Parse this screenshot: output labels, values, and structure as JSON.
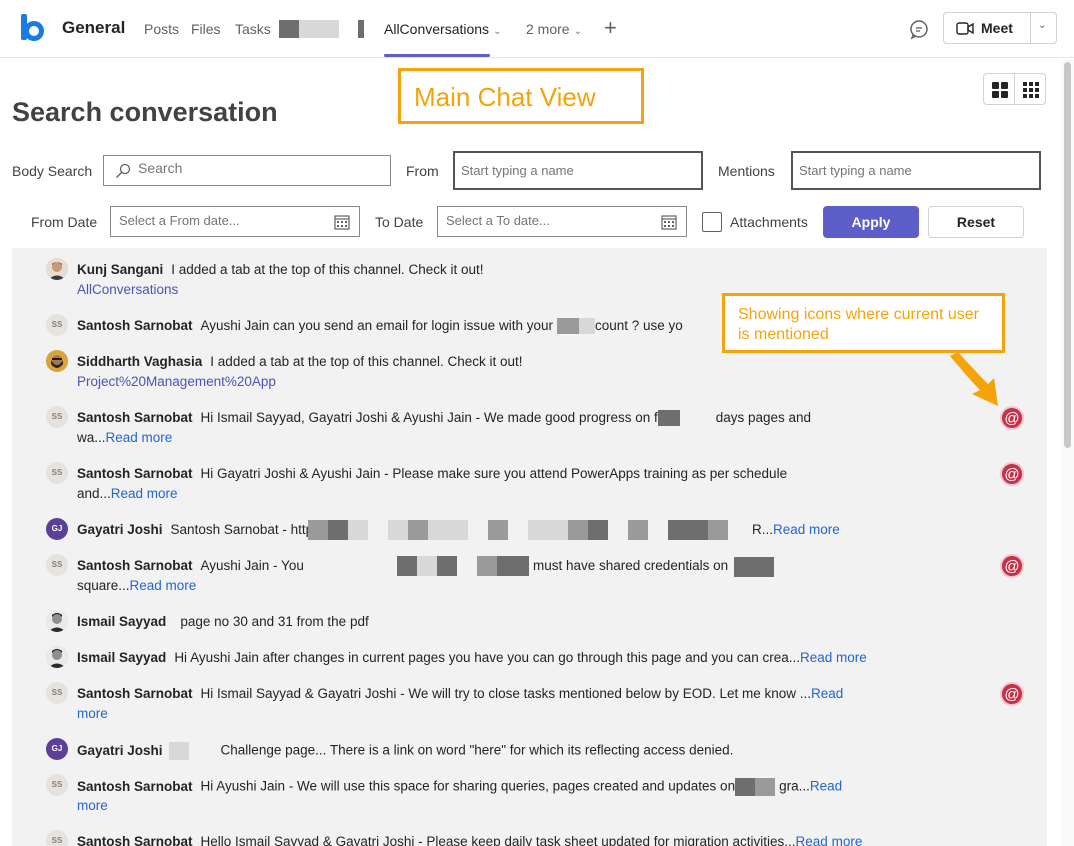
{
  "header": {
    "channel": "General",
    "tabs": [
      "Posts",
      "Files",
      "Tasks"
    ],
    "active_tab": "AllConversations",
    "more_tabs": "2 more",
    "meet_label": "Meet"
  },
  "annotations": {
    "main": "Main Chat View",
    "icons": "Showing icons where current user is mentioned"
  },
  "page_title": "Search conversation",
  "filters": {
    "body_search_label": "Body Search",
    "search_placeholder": "Search",
    "from_label": "From",
    "from_placeholder": "Start typing a name",
    "mentions_label": "Mentions",
    "mentions_placeholder": "Start typing a name",
    "from_date_label": "From Date",
    "from_date_placeholder": "Select a From date...",
    "to_date_label": "To Date",
    "to_date_placeholder": "Select a To date...",
    "attachments_label": "Attachments",
    "apply_label": "Apply",
    "reset_label": "Reset"
  },
  "messages": [
    {
      "author": "Kunj Sangani",
      "avatar": "",
      "text": "I added a tab at the top of this channel. Check it out!",
      "line2": "AllConversations",
      "mentioned": false
    },
    {
      "author": "Santosh Sarnobat",
      "avatar": "SS",
      "text": "Ayushi Jain can you send an email for login issue with your",
      "text_tail": "count ? use yo",
      "mentioned": false
    },
    {
      "author": "Siddharth Vaghasia",
      "avatar": "",
      "text": "I added a tab at the top of this channel. Check it out!",
      "line2": "Project%20Management%20App",
      "mentioned": false
    },
    {
      "author": "Santosh Sarnobat",
      "avatar": "SS",
      "text": "Hi Ismail Sayyad, Gayatri Joshi & Ayushi Jain - We made good progress on f",
      "text_tail": "days pages and",
      "line2": "wa...",
      "read_more": "Read more",
      "mentioned": true
    },
    {
      "author": "Santosh Sarnobat",
      "avatar": "SS",
      "text": "Hi Gayatri Joshi & Ayushi Jain - Please make sure you attend PowerApps training as per schedule",
      "line2": "and...",
      "read_more": "Read more",
      "mentioned": true
    },
    {
      "author": "Gayatri Joshi",
      "avatar": "GJ",
      "text": "Santosh Sarnobat - http",
      "text_tail": "R...",
      "read_more": "Read more",
      "mentioned": false
    },
    {
      "author": "Santosh Sarnobat",
      "avatar": "SS",
      "text": "Ayushi Jain - You",
      "text_tail": "must have shared credentials on",
      "line2": "square...",
      "read_more": "Read more",
      "mentioned": true
    },
    {
      "author": "Ismail Sayyad",
      "avatar": "",
      "text": "page no 30 and 31 from the pdf",
      "mentioned": false
    },
    {
      "author": "Ismail Sayyad",
      "avatar": "",
      "text": "Hi Ayushi Jain after changes in current pages you have you can go through this page and you can crea...",
      "read_more": "Read more",
      "mentioned": false
    },
    {
      "author": "Santosh Sarnobat",
      "avatar": "SS",
      "text": "Hi Ismail Sayyad & Gayatri Joshi - We will try to close tasks mentioned below by EOD. Let me know ...",
      "read_more": "Read",
      "line2_link": "more",
      "mentioned": true
    },
    {
      "author": "Gayatri Joshi",
      "avatar": "GJ",
      "text": "Challenge page... There is a link on word \"here\" for which its reflecting access denied.",
      "mentioned": false
    },
    {
      "author": "Santosh Sarnobat",
      "avatar": "SS",
      "text": "Hi Ayushi Jain - We will use this space for sharing queries, pages created and updates on",
      "text_tail": "gra...",
      "read_more": "Read",
      "line2_link": "more",
      "mentioned": false
    },
    {
      "author": "Santosh Sarnobat",
      "avatar": "SS",
      "text": "Hello Ismail Sayyad & Gayatri Joshi - Please keep daily task sheet updated for migration activities...",
      "read_more": "Read more",
      "mentioned": false
    }
  ],
  "colors": {
    "accent": "#5b5fc7",
    "mention": "#c4314b",
    "annotation": "#f5a30a",
    "link": "#2266cc"
  }
}
